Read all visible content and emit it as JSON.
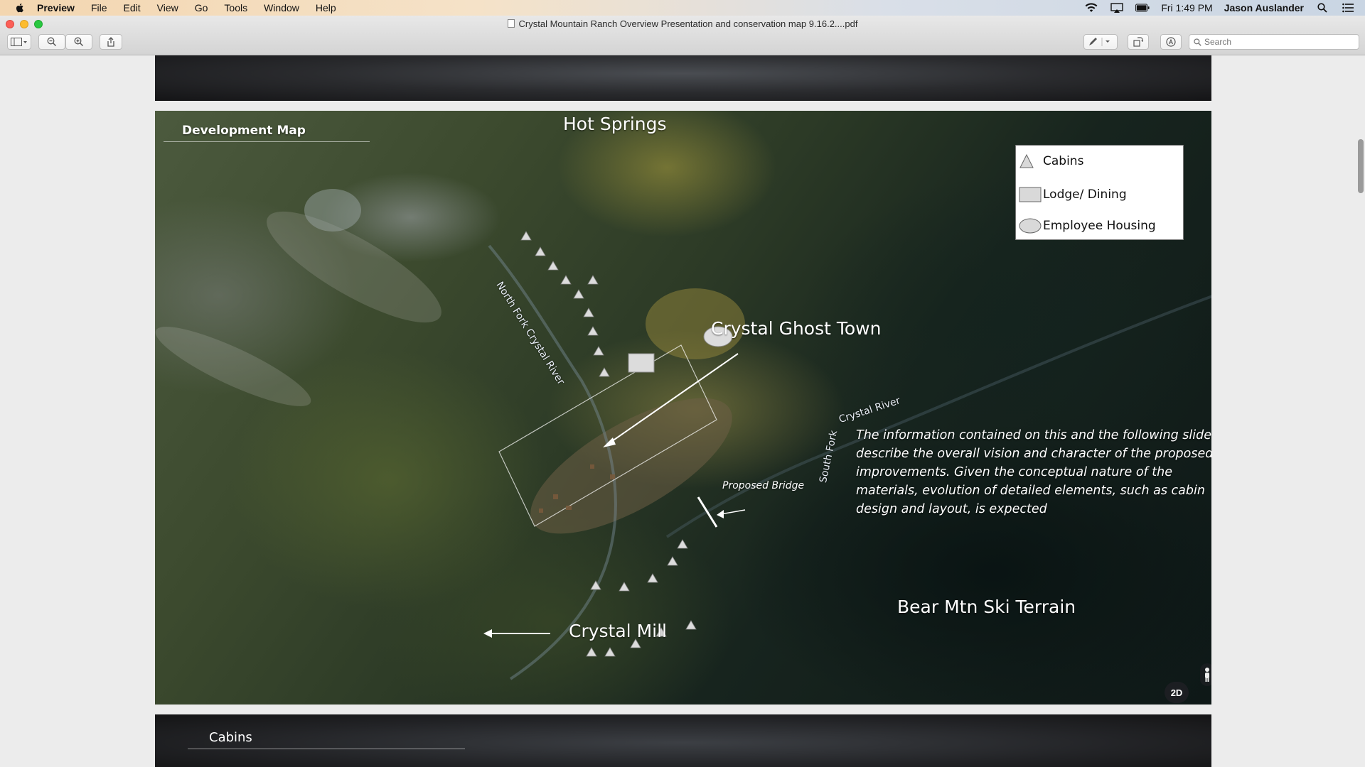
{
  "menubar": {
    "app_name": "Preview",
    "menus": [
      "File",
      "Edit",
      "View",
      "Go",
      "Tools",
      "Window",
      "Help"
    ],
    "clock": "Fri 1:49 PM",
    "user": "Jason Auslander",
    "icons": [
      "wifi-icon",
      "airplay-icon",
      "battery-icon",
      "spotlight-icon",
      "notification-center-icon"
    ]
  },
  "window": {
    "title": "Crystal Mountain Ranch Overview Presentation and conservation map 9.16.2....pdf",
    "search_placeholder": "Search"
  },
  "slide": {
    "section_title": "Development Map",
    "labels": {
      "hot_springs": "Hot Springs",
      "ghost_town": "Crystal Ghost Town",
      "bear_mtn": "Bear Mtn Ski Terrain",
      "crystal_mill": "Crystal Mill",
      "proposed_bridge": "Proposed Bridge",
      "north_river": "North Fork Crystal River",
      "south_river_a": "South Fork",
      "south_river_b": "Crystal River"
    },
    "info_text": "The information contained on this and the following slides describe the overall vision and character of the proposed improvements. Given the conceptual nature of the materials, evolution of detailed elements, such as cabin design and layout, is expected",
    "legend": {
      "cabins": "Cabins",
      "lodge": "Lodge/ Dining",
      "housing": "Employee Housing"
    },
    "map_controls": {
      "view_mode": "2D",
      "zoom_out": "−",
      "zoom_in": "+"
    }
  },
  "next_slide": {
    "title": "Cabins"
  },
  "colors": {
    "legend_fill": "#d9d9d9",
    "marker_fill": "#dcdcdc"
  }
}
